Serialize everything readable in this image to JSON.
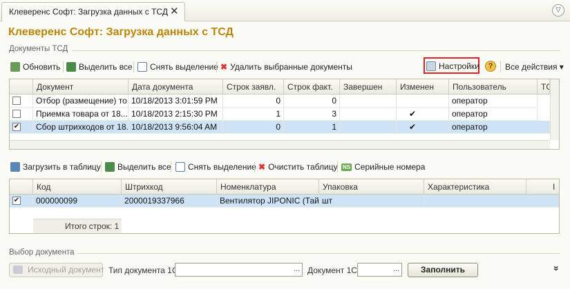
{
  "tab": {
    "title": "Клеверенс Софт: Загрузка данных с ТСД",
    "close": "✕",
    "menu": "▽"
  },
  "page_title": "Клеверенс Софт: Загрузка данных с ТСД",
  "docs_group": "Документы ТСД",
  "toolbar1": {
    "refresh": "Обновить",
    "select_all": "Выделить все",
    "deselect": "Снять выделение",
    "delete_docs": "Удалить выбранные документы",
    "settings": "Настройки",
    "help": "?",
    "all_actions": "Все действия ▾"
  },
  "grid1": {
    "columns": [
      "Документ",
      "Дата документа",
      "Строк заявл.",
      "Строк факт.",
      "Завершен",
      "Изменен",
      "Пользователь",
      "ТС"
    ],
    "rows": [
      {
        "checked": "",
        "doc": "Отбор (размещение) то...",
        "date": "10/18/2013 3:01:59 PM",
        "declared": "0",
        "fact": "0",
        "done": "",
        "changed": "",
        "user": "оператор"
      },
      {
        "checked": "",
        "doc": "Приемка товара от 18....",
        "date": "10/18/2013 2:15:30 PM",
        "declared": "1",
        "fact": "3",
        "done": "",
        "changed": "✔",
        "user": "оператор"
      },
      {
        "checked": "✔",
        "doc": "Сбор штрихкодов от 18....",
        "date": "10/18/2013 9:56:04 AM",
        "declared": "0",
        "fact": "1",
        "done": "",
        "changed": "✔",
        "user": "оператор"
      }
    ]
  },
  "toolbar2": {
    "load": "Загрузить в таблицу",
    "select_all": "Выделить все",
    "deselect": "Снять выделение",
    "clear": "Очистить таблицу",
    "serials_icon": "NS",
    "serials": "Серийные номера"
  },
  "grid2": {
    "columns": [
      "Код",
      "Штрихкод",
      "Номенклатура",
      "Упаковка",
      "Характеристика",
      "I"
    ],
    "rows": [
      {
        "checked": "✔",
        "code": "000000099",
        "barcode": "2000019337966",
        "item": "Вентилятор JIPONIC (Тай...",
        "pack": "шт",
        "char": ""
      }
    ],
    "total": "Итого строк: 1"
  },
  "choose_group": "Выбор документа",
  "bottom": {
    "source_doc": "Исходный документ",
    "doc_type_label": "Тип документа 1С:",
    "doc_label": "Документ 1С:",
    "dots": "...",
    "fill": "Заполнить",
    "more": "»"
  }
}
